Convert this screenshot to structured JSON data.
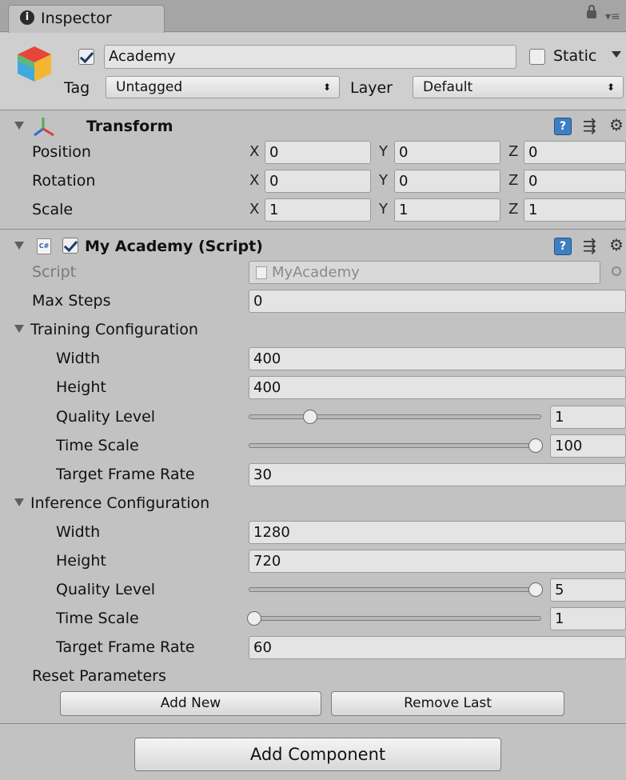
{
  "tab": {
    "title": "Inspector",
    "info_glyph": "❶",
    "lock_glyph": "🔒",
    "menu_glyph": "▾≡"
  },
  "gameobject": {
    "name": "Academy",
    "active": true,
    "static_label": "Static",
    "static_checked": false,
    "tag_label": "Tag",
    "tag_value": "Untagged",
    "layer_label": "Layer",
    "layer_value": "Default"
  },
  "transform": {
    "title": "Transform",
    "rows": [
      {
        "label": "Position",
        "x": "0",
        "y": "0",
        "z": "0"
      },
      {
        "label": "Rotation",
        "x": "0",
        "y": "0",
        "z": "0"
      },
      {
        "label": "Scale",
        "x": "1",
        "y": "1",
        "z": "1"
      }
    ],
    "axis_x": "X",
    "axis_y": "Y",
    "axis_z": "Z"
  },
  "script_component": {
    "title": "My Academy (Script)",
    "enabled": true,
    "script_label": "Script",
    "script_value": "MyAcademy",
    "max_steps_label": "Max Steps",
    "max_steps_value": "0"
  },
  "training": {
    "title": "Training Configuration",
    "width_label": "Width",
    "width_value": "400",
    "height_label": "Height",
    "height_value": "400",
    "quality_label": "Quality Level",
    "quality_value": "1",
    "quality_fraction": 0.2,
    "timescale_label": "Time Scale",
    "timescale_value": "100",
    "timescale_fraction": 1.0,
    "framerate_label": "Target Frame Rate",
    "framerate_value": "30"
  },
  "inference": {
    "title": "Inference Configuration",
    "width_label": "Width",
    "width_value": "1280",
    "height_label": "Height",
    "height_value": "720",
    "quality_label": "Quality Level",
    "quality_value": "5",
    "quality_fraction": 1.0,
    "timescale_label": "Time Scale",
    "timescale_value": "1",
    "timescale_fraction": 0.0,
    "framerate_label": "Target Frame Rate",
    "framerate_value": "60"
  },
  "reset": {
    "title": "Reset Parameters",
    "add_new": "Add New",
    "remove_last": "Remove Last"
  },
  "add_component": "Add Component",
  "colors": {
    "bg": "#c2c2c2",
    "header": "#d6d6d6",
    "help_blue": "#3e7fc4"
  }
}
